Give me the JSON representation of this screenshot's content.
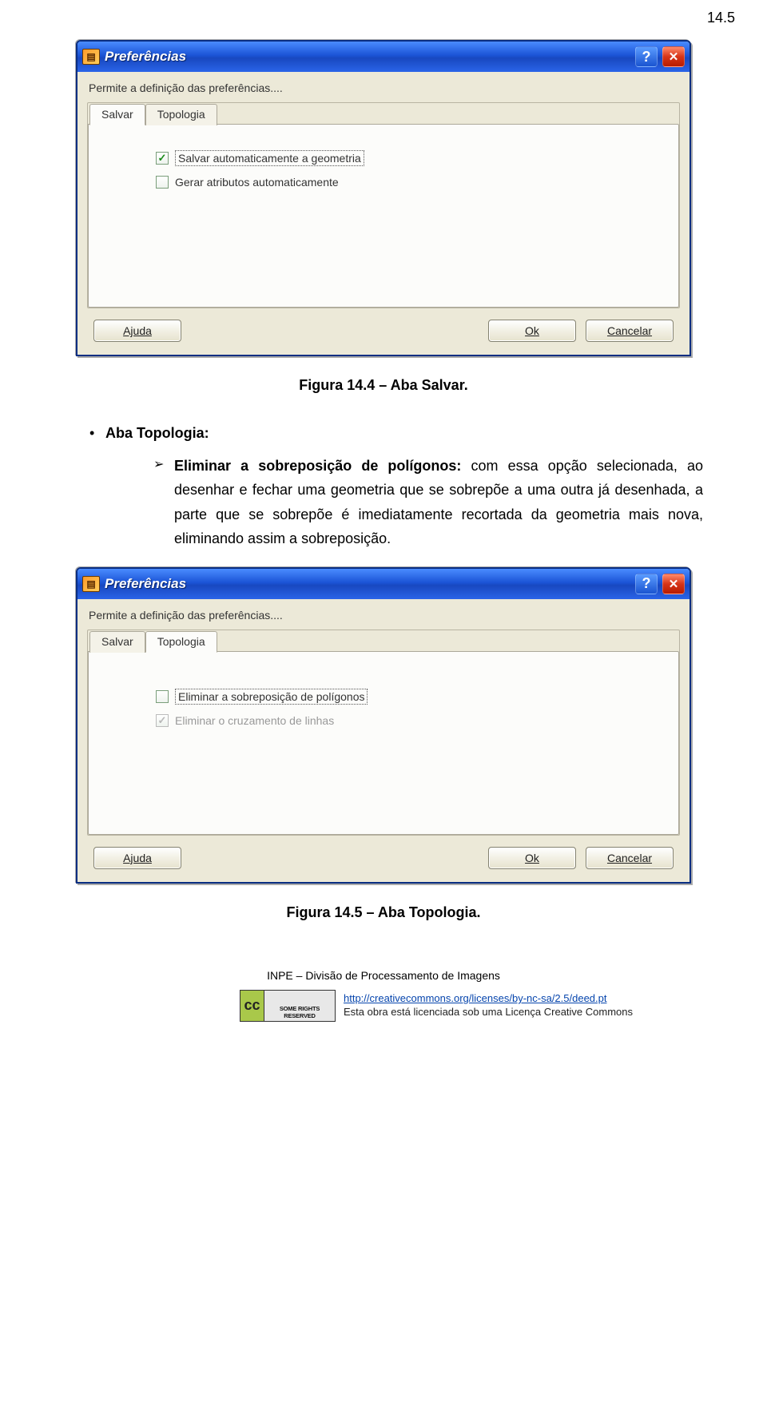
{
  "page_num": "14.5",
  "dialog1": {
    "title": "Preferências",
    "desc": "Permite a definição das preferências....",
    "tabs": {
      "salvar": "Salvar",
      "topologia": "Topologia"
    },
    "active_tab": "salvar",
    "opts": {
      "auto_save": {
        "label": "Salvar automaticamente a geometria",
        "checked": true,
        "focused": true
      },
      "auto_attr": {
        "label": "Gerar atributos automaticamente",
        "checked": false
      }
    },
    "buttons": {
      "help": "Ajuda",
      "ok": "Ok",
      "cancel": "Cancelar"
    }
  },
  "caption1": "Figura 14.4 – Aba Salvar.",
  "section": {
    "heading": "Aba Topologia:",
    "item_label": "Eliminar a sobreposição de polígonos:",
    "item_rest": " com essa opção selecionada, ao desenhar e fechar uma geometria que se sobrepõe a uma outra já desenhada, a parte que se sobrepõe é imediatamente recortada da geometria mais nova, eliminando assim a sobreposição."
  },
  "dialog2": {
    "title": "Preferências",
    "desc": "Permite a definição das preferências....",
    "tabs": {
      "salvar": "Salvar",
      "topologia": "Topologia"
    },
    "active_tab": "topologia",
    "opts": {
      "elim_poly": {
        "label": "Eliminar a sobreposição de polígonos",
        "checked": false,
        "focused": true
      },
      "elim_lines": {
        "label": "Eliminar o cruzamento de linhas",
        "checked": true,
        "disabled": true
      }
    },
    "buttons": {
      "help": "Ajuda",
      "ok": "Ok",
      "cancel": "Cancelar"
    }
  },
  "caption2": "Figura 14.5 – Aba Topologia.",
  "footer": {
    "org": "INPE – Divisão de Processamento de Imagens",
    "cc_badge_left": "cc",
    "cc_badge_right": "SOME RIGHTS RESERVED",
    "cc_url": "http://creativecommons.org/licenses/by-nc-sa/2.5/deed.pt",
    "cc_line": "Esta obra está licenciada sob uma Licença Creative Commons"
  }
}
